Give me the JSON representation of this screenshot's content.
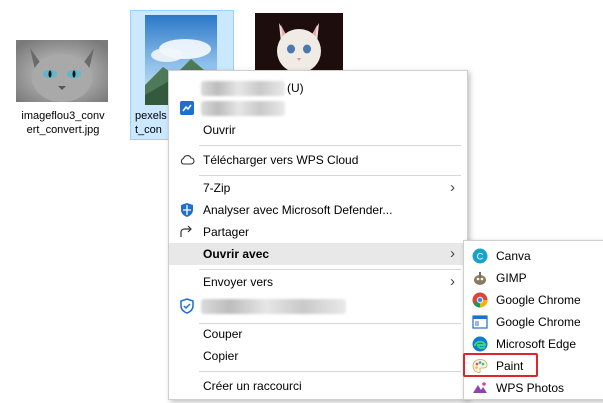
{
  "files": [
    {
      "name": "imageflou3_convert_convert.jpg",
      "name_line1": "imageflou3_conv",
      "name_line2": "ert_convert.jpg"
    },
    {
      "name_line1": "pexels",
      "name_line2": "t_con"
    },
    {
      "name": ""
    }
  ],
  "context_menu": {
    "top_suffix": "(U)",
    "open": "Ouvrir",
    "wps_upload": "Télécharger vers WPS Cloud",
    "sevenzip": "7-Zip",
    "defender": "Analyser avec Microsoft Defender...",
    "share": "Partager",
    "open_with": "Ouvrir avec",
    "send_to": "Envoyer vers",
    "cut": "Couper",
    "copy": "Copier",
    "shortcut": "Créer un raccourci",
    "arrow": "›"
  },
  "open_with_submenu": {
    "items": [
      "Canva",
      "GIMP",
      "Google Chrome",
      "Google Chrome",
      "Microsoft Edge",
      "Paint",
      "WPS Photos"
    ],
    "highlighted": "Paint"
  },
  "colors": {
    "selection_bg": "#cce8ff",
    "highlight_border": "#e0242c",
    "hover_bg": "#e8e8e8"
  }
}
